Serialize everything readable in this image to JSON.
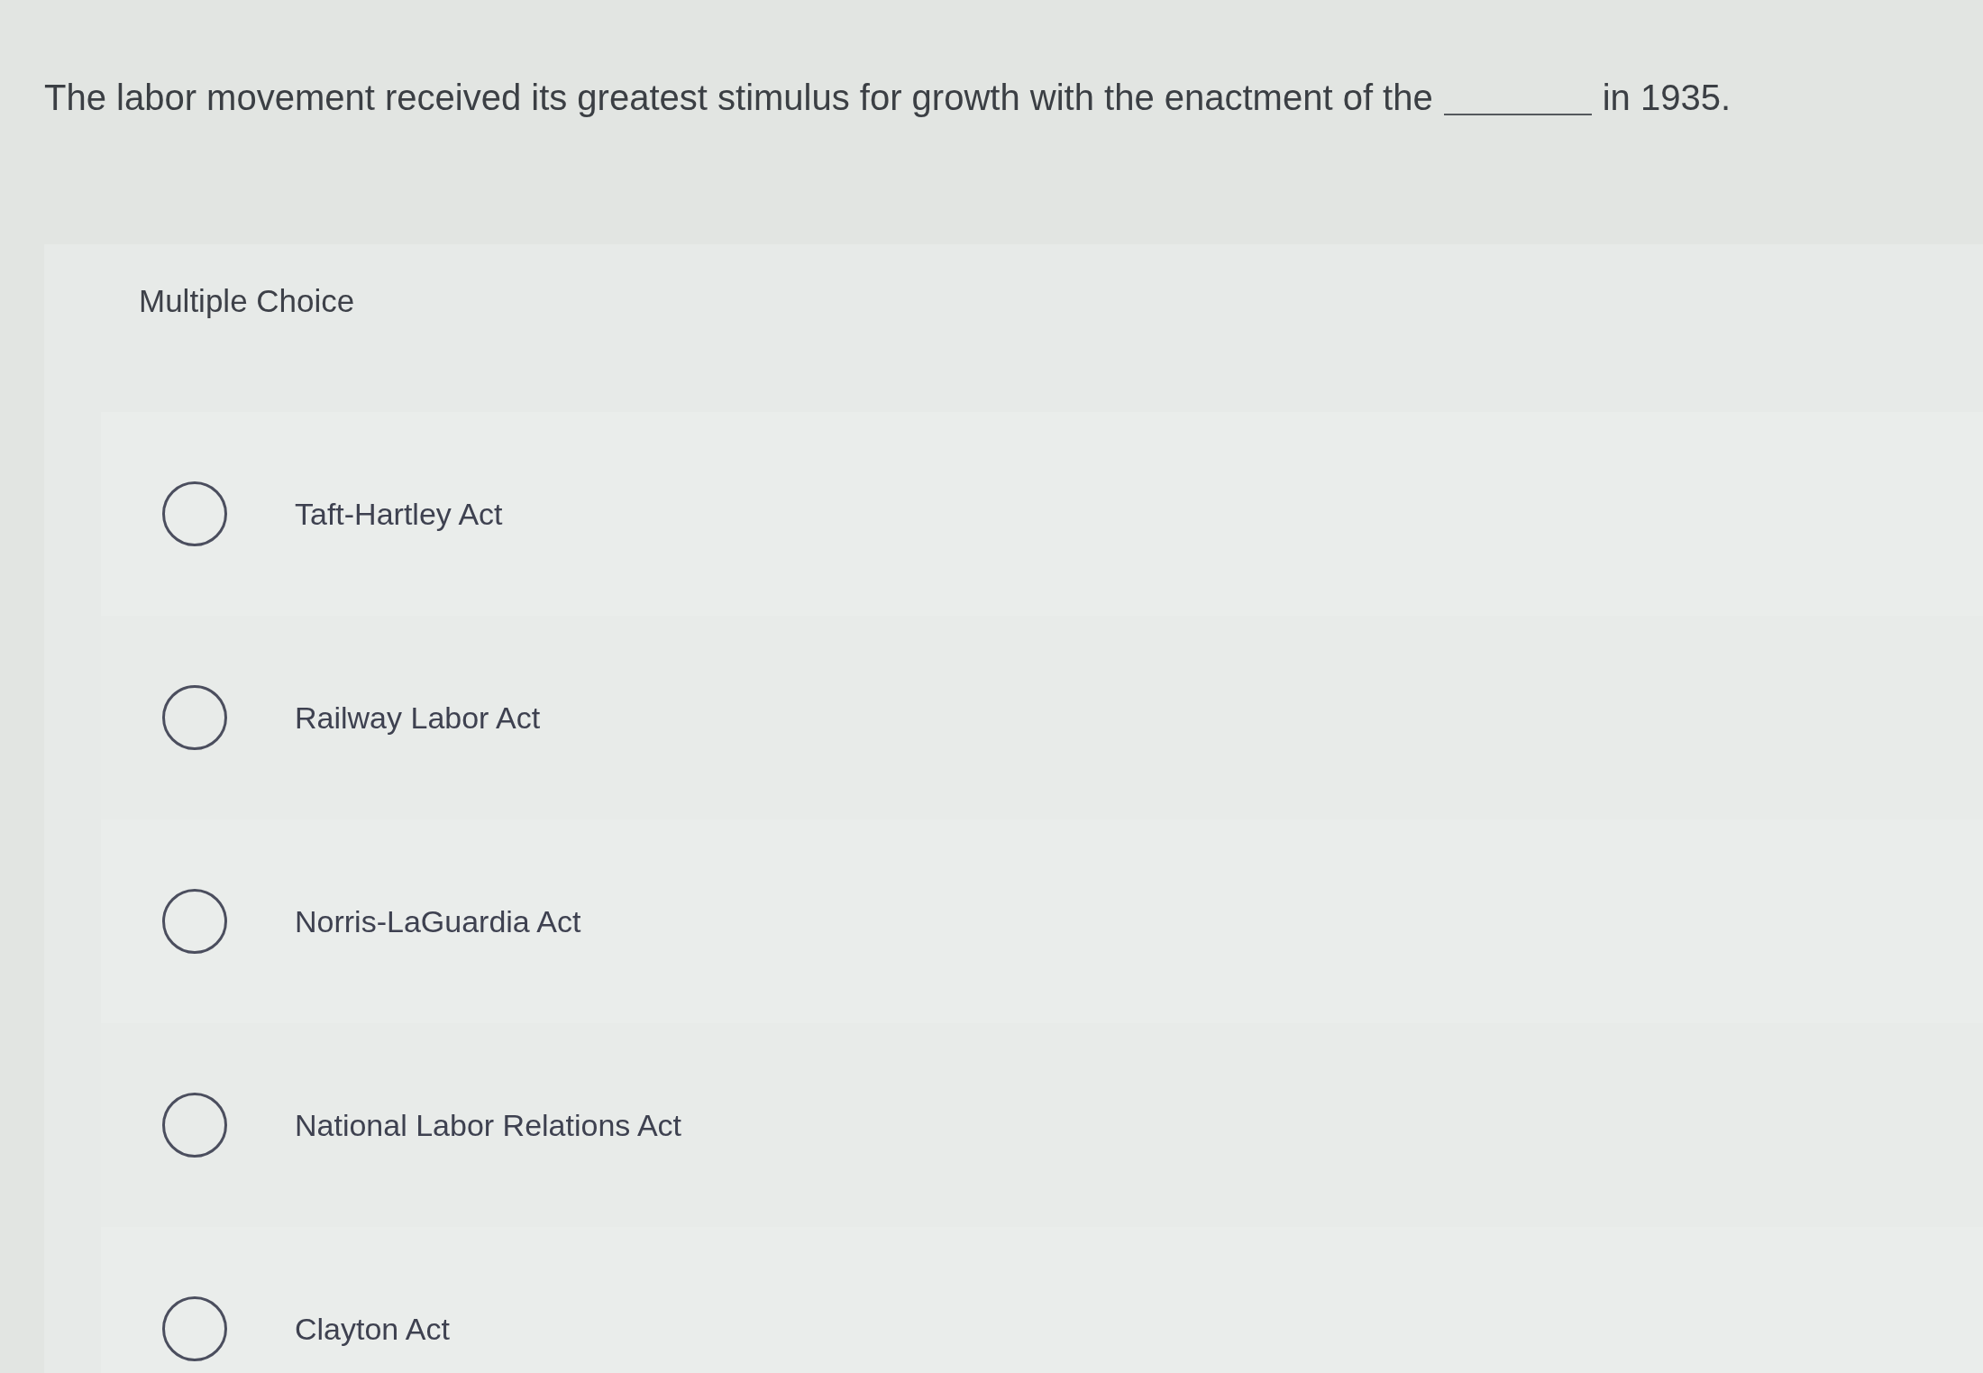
{
  "question": {
    "before": "The labor movement received its greatest stimulus for growth with the enactment of the",
    "after": "in 1935."
  },
  "answer_area": {
    "label": "Multiple Choice",
    "options": [
      {
        "label": "Taft-Hartley Act",
        "selected": false
      },
      {
        "label": "Railway Labor Act",
        "selected": false
      },
      {
        "label": "Norris-LaGuardia Act",
        "selected": false
      },
      {
        "label": "National Labor Relations Act",
        "selected": false
      },
      {
        "label": "Clayton Act",
        "selected": false
      }
    ]
  }
}
